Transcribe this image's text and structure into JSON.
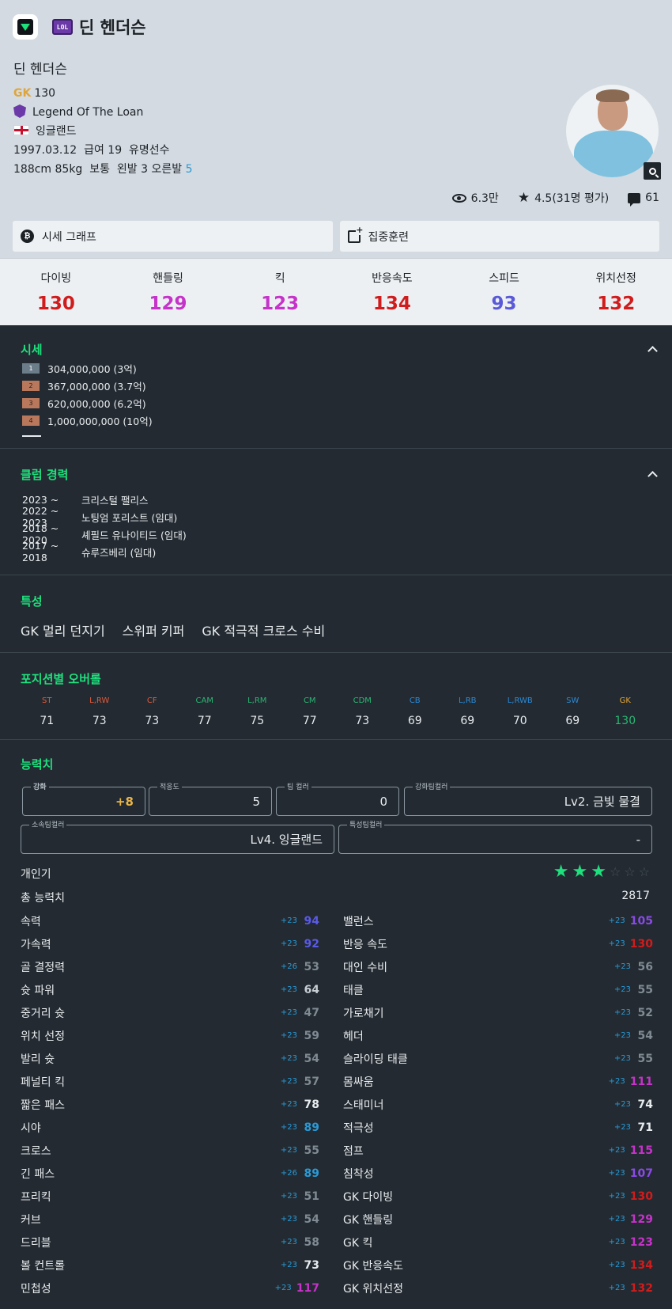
{
  "app": {
    "icon": "app-logo-icon",
    "season_badge": "LOL",
    "title": "딘 헨더슨"
  },
  "player": {
    "name": "딘 헨더슨",
    "position": "GK",
    "ovr": "130",
    "season_name": "Legend Of The Loan",
    "nation": "잉글랜드",
    "birth": "1997.03.12",
    "salary": "급여 19",
    "fame": "유명선수",
    "body": "188cm 85kg",
    "build": "보통",
    "left_foot": "왼발 3",
    "right_foot": "오른발",
    "right_foot_val": "5"
  },
  "stats_line": {
    "views": "6.3만",
    "rating": "4.5(31명 평가)",
    "comments": "61"
  },
  "buttons": {
    "price_graph": "시세 그래프",
    "training": "집중훈련"
  },
  "summary": [
    {
      "label": "다이빙",
      "value": "130",
      "color": "#d01c1c"
    },
    {
      "label": "핸들링",
      "value": "129",
      "color": "#c533c9"
    },
    {
      "label": "킥",
      "value": "123",
      "color": "#c533c9"
    },
    {
      "label": "반응속도",
      "value": "134",
      "color": "#d01c1c"
    },
    {
      "label": "스피드",
      "value": "93",
      "color": "#5a5ad8"
    },
    {
      "label": "위치선정",
      "value": "132",
      "color": "#d01c1c"
    }
  ],
  "price": {
    "title": "시세",
    "rows": [
      {
        "rank": "1",
        "text": "304,000,000 (3억)"
      },
      {
        "rank": "2",
        "text": "367,000,000 (3.7억)"
      },
      {
        "rank": "3",
        "text": "620,000,000 (6.2억)"
      },
      {
        "rank": "4",
        "text": "1,000,000,000 (10억)"
      }
    ]
  },
  "career": {
    "title": "클럽 경력",
    "rows": [
      {
        "period": "2023 ~",
        "club": "크리스털 팰리스"
      },
      {
        "period": "2022 ~ 2023",
        "club": "노팅엄 포리스트 (임대)"
      },
      {
        "period": "2018 ~ 2020",
        "club": "셰필드 유나이티드 (임대)"
      },
      {
        "period": "2017 ~ 2018",
        "club": "슈루즈베리 (임대)"
      }
    ]
  },
  "traits": {
    "title": "특성",
    "items": [
      "GK 멀리 던지기",
      "스위퍼 키퍼",
      "GK 적극적 크로스 수비"
    ]
  },
  "positions": {
    "title": "포지션별 오버롤",
    "items": [
      {
        "pos": "ST",
        "val": "71",
        "color": "#e05a3a"
      },
      {
        "pos": "L,RW",
        "val": "73",
        "color": "#e05a3a"
      },
      {
        "pos": "CF",
        "val": "73",
        "color": "#e05a3a"
      },
      {
        "pos": "CAM",
        "val": "77",
        "color": "#2bb673"
      },
      {
        "pos": "L,RM",
        "val": "75",
        "color": "#2bb673"
      },
      {
        "pos": "CM",
        "val": "77",
        "color": "#2bb673"
      },
      {
        "pos": "CDM",
        "val": "73",
        "color": "#2bb673"
      },
      {
        "pos": "CB",
        "val": "69",
        "color": "#2a8ad6"
      },
      {
        "pos": "L,RB",
        "val": "69",
        "color": "#2a8ad6"
      },
      {
        "pos": "L,RWB",
        "val": "70",
        "color": "#2a8ad6"
      },
      {
        "pos": "SW",
        "val": "69",
        "color": "#2a8ad6"
      },
      {
        "pos": "GK",
        "val": "130",
        "color": "#e0a53a"
      }
    ]
  },
  "ability": {
    "title": "능력치",
    "enhance": {
      "label": "강화",
      "value": "+8"
    },
    "adapt": {
      "label": "적응도",
      "value": "5"
    },
    "team_color": {
      "label": "팀 컬러",
      "value": "0"
    },
    "enhance_team_color": {
      "label": "강화팀컬러",
      "value": "Lv2. 금빛 물결"
    },
    "club_team_color": {
      "label": "소속팀컬러",
      "value": "Lv4. 잉글랜드"
    },
    "trait_team_color": {
      "label": "특성팀컬러",
      "value": "-"
    },
    "popularity_label": "개인기",
    "popularity_stars": 3,
    "total_label": "총 능력치",
    "total_value": "2817",
    "attrs": [
      [
        {
          "name": "속력",
          "plus": "+23",
          "val": "94",
          "color": "#5a5ae8"
        },
        {
          "name": "밸런스",
          "plus": "+23",
          "val": "105",
          "color": "#8a4ae8"
        }
      ],
      [
        {
          "name": "가속력",
          "plus": "+23",
          "val": "92",
          "color": "#5a5ae8"
        },
        {
          "name": "반응 속도",
          "plus": "+23",
          "val": "130",
          "color": "#d01c1c"
        }
      ],
      [
        {
          "name": "골 결정력",
          "plus": "+26",
          "val": "53",
          "color": "#7f8a93"
        },
        {
          "name": "대인 수비",
          "plus": "+23",
          "val": "56",
          "color": "#7f8a93"
        }
      ],
      [
        {
          "name": "슛 파워",
          "plus": "+23",
          "val": "64",
          "color": "#c7ced4"
        },
        {
          "name": "태클",
          "plus": "+23",
          "val": "55",
          "color": "#7f8a93"
        }
      ],
      [
        {
          "name": "중거리 슛",
          "plus": "+23",
          "val": "47",
          "color": "#7f8a93"
        },
        {
          "name": "가로채기",
          "plus": "+23",
          "val": "52",
          "color": "#7f8a93"
        }
      ],
      [
        {
          "name": "위치 선정",
          "plus": "+23",
          "val": "59",
          "color": "#7f8a93"
        },
        {
          "name": "헤더",
          "plus": "+23",
          "val": "54",
          "color": "#7f8a93"
        }
      ],
      [
        {
          "name": "발리 슛",
          "plus": "+23",
          "val": "54",
          "color": "#7f8a93"
        },
        {
          "name": "슬라이딩 태클",
          "plus": "+23",
          "val": "55",
          "color": "#7f8a93"
        }
      ],
      [
        {
          "name": "페널티 킥",
          "plus": "+23",
          "val": "57",
          "color": "#7f8a93"
        },
        {
          "name": "몸싸움",
          "plus": "+23",
          "val": "111",
          "color": "#c533c9"
        }
      ],
      [
        {
          "name": "짧은 패스",
          "plus": "+23",
          "val": "78",
          "color": "#e8ecef"
        },
        {
          "name": "스태미너",
          "plus": "+23",
          "val": "74",
          "color": "#e8ecef"
        }
      ],
      [
        {
          "name": "시야",
          "plus": "+23",
          "val": "89",
          "color": "#2a9ad6"
        },
        {
          "name": "적극성",
          "plus": "+23",
          "val": "71",
          "color": "#e8ecef"
        }
      ],
      [
        {
          "name": "크로스",
          "plus": "+23",
          "val": "55",
          "color": "#7f8a93"
        },
        {
          "name": "점프",
          "plus": "+23",
          "val": "115",
          "color": "#c533c9"
        }
      ],
      [
        {
          "name": "긴 패스",
          "plus": "+26",
          "val": "89",
          "color": "#2a9ad6"
        },
        {
          "name": "침착성",
          "plus": "+23",
          "val": "107",
          "color": "#8a4ae8"
        }
      ],
      [
        {
          "name": "프리킥",
          "plus": "+23",
          "val": "51",
          "color": "#7f8a93"
        },
        {
          "name": "GK 다이빙",
          "plus": "+23",
          "val": "130",
          "color": "#d01c1c"
        }
      ],
      [
        {
          "name": "커브",
          "plus": "+23",
          "val": "54",
          "color": "#7f8a93"
        },
        {
          "name": "GK 핸들링",
          "plus": "+23",
          "val": "129",
          "color": "#c533c9"
        }
      ],
      [
        {
          "name": "드리블",
          "plus": "+23",
          "val": "58",
          "color": "#7f8a93"
        },
        {
          "name": "GK 킥",
          "plus": "+23",
          "val": "123",
          "color": "#c533c9"
        }
      ],
      [
        {
          "name": "볼 컨트롤",
          "plus": "+23",
          "val": "73",
          "color": "#e8ecef"
        },
        {
          "name": "GK 반응속도",
          "plus": "+23",
          "val": "134",
          "color": "#d01c1c"
        }
      ],
      [
        {
          "name": "민첩성",
          "plus": "+23",
          "val": "117",
          "color": "#c533c9"
        },
        {
          "name": "GK 위치선정",
          "plus": "+23",
          "val": "132",
          "color": "#d01c1c"
        }
      ]
    ]
  }
}
